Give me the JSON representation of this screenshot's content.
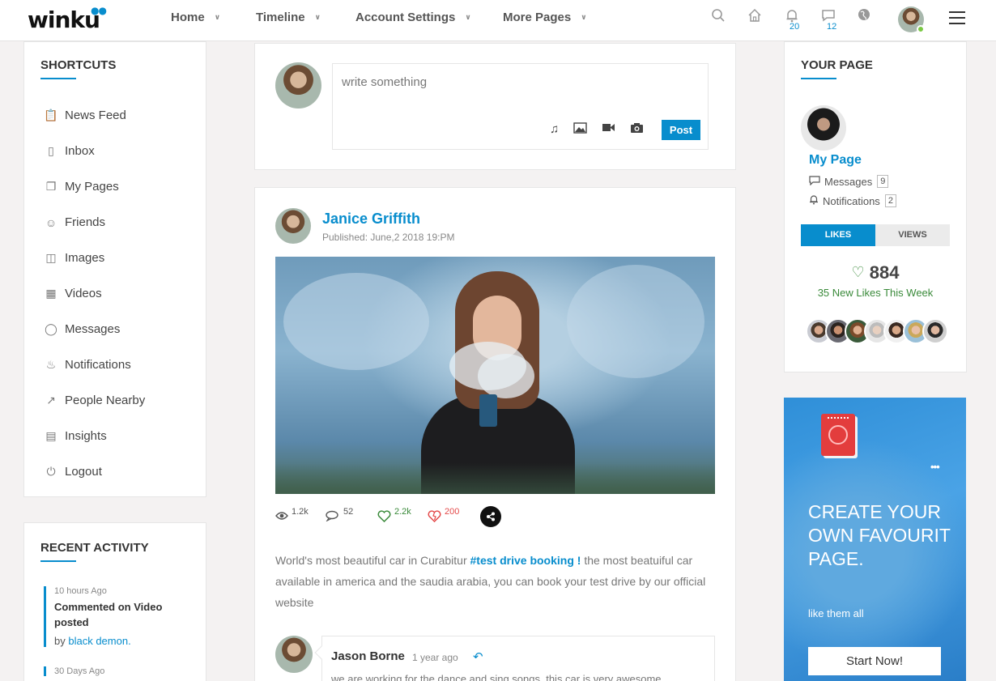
{
  "header": {
    "logo": "winku",
    "nav": [
      {
        "label": "Home"
      },
      {
        "label": "Timeline"
      },
      {
        "label": "Account Settings"
      },
      {
        "label": "More Pages"
      }
    ],
    "notifications_count": "20",
    "messages_count": "12"
  },
  "shortcuts": {
    "title": "SHORTCUTS",
    "items": [
      {
        "label": "News Feed",
        "icon": "clipboard-icon"
      },
      {
        "label": "Inbox",
        "icon": "mouse-icon"
      },
      {
        "label": "My Pages",
        "icon": "files-icon"
      },
      {
        "label": "Friends",
        "icon": "user-icon"
      },
      {
        "label": "Images",
        "icon": "image-icon"
      },
      {
        "label": "Videos",
        "icon": "video-icon"
      },
      {
        "label": "Messages",
        "icon": "chat-icon"
      },
      {
        "label": "Notifications",
        "icon": "bell-icon"
      },
      {
        "label": "People Nearby",
        "icon": "share-icon"
      },
      {
        "label": "Insights",
        "icon": "bar-chart-icon"
      },
      {
        "label": "Logout",
        "icon": "power-icon"
      }
    ]
  },
  "recent_activity": {
    "title": "RECENT ACTIVITY",
    "items": [
      {
        "time": "10 hours Ago",
        "text": "Commented on Video posted",
        "by_label": "by",
        "by_name": "black demon."
      },
      {
        "time": "30 Days Ago"
      }
    ]
  },
  "composer": {
    "placeholder": "write something",
    "post_label": "Post"
  },
  "post": {
    "author": "Janice Griffith",
    "published": "Published: June,2 2018 19:PM",
    "views": "1.2k",
    "comments": "52",
    "likes": "2.2k",
    "dislikes": "200",
    "text_before": "World's most beautiful car in Curabitur ",
    "hashtag": "#test drive booking !",
    "text_after": " the most beatuiful car available in america and the saudia arabia, you can book your test drive by our official website"
  },
  "comment": {
    "author": "Jason Borne",
    "time": "1 year ago",
    "text": "we are working for the dance and sing songs. this car is very awesome"
  },
  "your_page": {
    "title": "YOUR PAGE",
    "page_name": "My Page",
    "messages_label": "Messages",
    "messages_count": "9",
    "notifications_label": "Notifications",
    "notifications_count": "2",
    "tab_likes": "LIKES",
    "tab_views": "VIEWS",
    "likes_count": "884",
    "likes_week": "35 New Likes This Week"
  },
  "promo": {
    "title": "CREATE YOUR OWN FAVOURIT PAGE.",
    "subtitle": "like them all",
    "button": "Start Now!"
  },
  "colors": {
    "accent": "#088dcd",
    "like_green": "#3a8a3a",
    "dislike_red": "#e44a4a"
  }
}
